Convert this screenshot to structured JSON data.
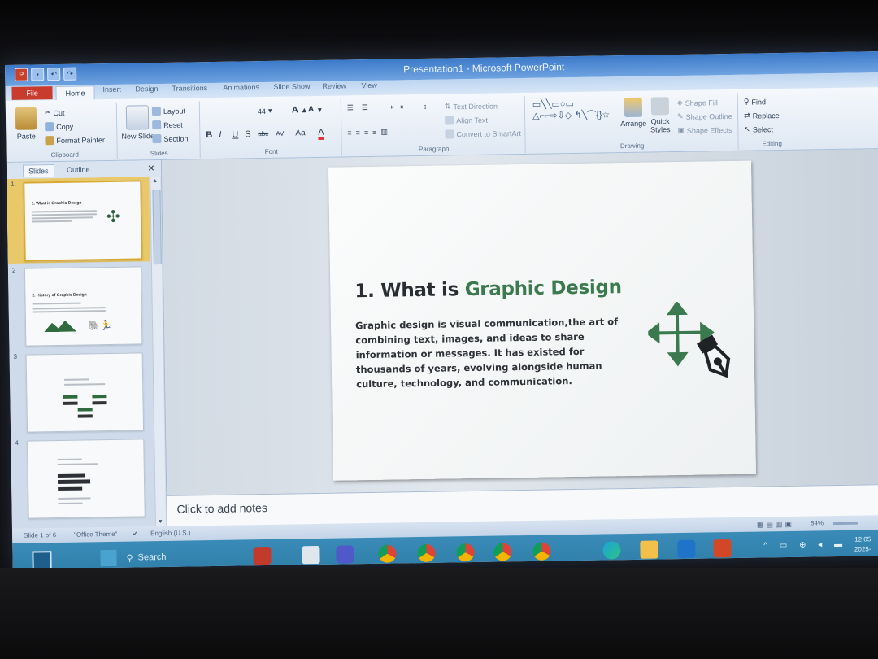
{
  "window": {
    "doc_name": "Presentation1",
    "app_name": "Microsoft PowerPoint",
    "title_sep": " - "
  },
  "tabs": {
    "file": "File",
    "home": "Home",
    "others": [
      "Insert",
      "Design",
      "Transitions",
      "Animations",
      "Slide Show",
      "Review",
      "View"
    ]
  },
  "ribbon": {
    "clipboard": {
      "label": "Clipboard",
      "paste": "Paste",
      "cut": "Cut",
      "copy": "Copy",
      "format_painter": "Format Painter"
    },
    "slides": {
      "label": "Slides",
      "new_slide": "New Slide",
      "layout": "Layout",
      "reset": "Reset",
      "section": "Section"
    },
    "font": {
      "label": "Font",
      "size": "44",
      "bold": "B",
      "italic": "I",
      "underline": "U",
      "shadow": "S",
      "strike": "abc",
      "spacing": "AV",
      "case": "Aa",
      "color": "A"
    },
    "paragraph": {
      "label": "Paragraph",
      "text_direction": "Text Direction",
      "align_text": "Align Text",
      "smartart": "Convert to SmartArt"
    },
    "drawing": {
      "label": "Drawing",
      "arrange": "Arrange",
      "quick_styles": "Quick Styles",
      "shape_fill": "Shape Fill",
      "shape_outline": "Shape Outline",
      "shape_effects": "Shape Effects"
    },
    "editing": {
      "label": "Editing",
      "find": "Find",
      "replace": "Replace",
      "select": "Select"
    }
  },
  "left_pane": {
    "tab_slides": "Slides",
    "tab_outline": "Outline",
    "close": "×",
    "thumbnails": [
      {
        "num": "1",
        "title": "1. What is Graphic Design"
      },
      {
        "num": "2",
        "title": "2. History of Graphic Design"
      },
      {
        "num": "3",
        "title": ""
      },
      {
        "num": "4",
        "title": ""
      }
    ]
  },
  "slide": {
    "title_prefix": "1. What is ",
    "title_accent": "Graphic Design",
    "body": "Graphic design is visual communication,the art of combining text, images, and ideas to share information or messages. It has existed for thousands of years, evolving alongside human culture, technology, and communication.",
    "accent_color": "#3b7a4e"
  },
  "notes": {
    "placeholder": "Click to add notes"
  },
  "status": {
    "slide_info": "Slide 1 of 6",
    "theme": "\"Office Theme\"",
    "language": "English (U.S.)",
    "zoom": "64%"
  },
  "taskbar": {
    "search": "Search",
    "time": "12:05",
    "date": "2025-"
  }
}
